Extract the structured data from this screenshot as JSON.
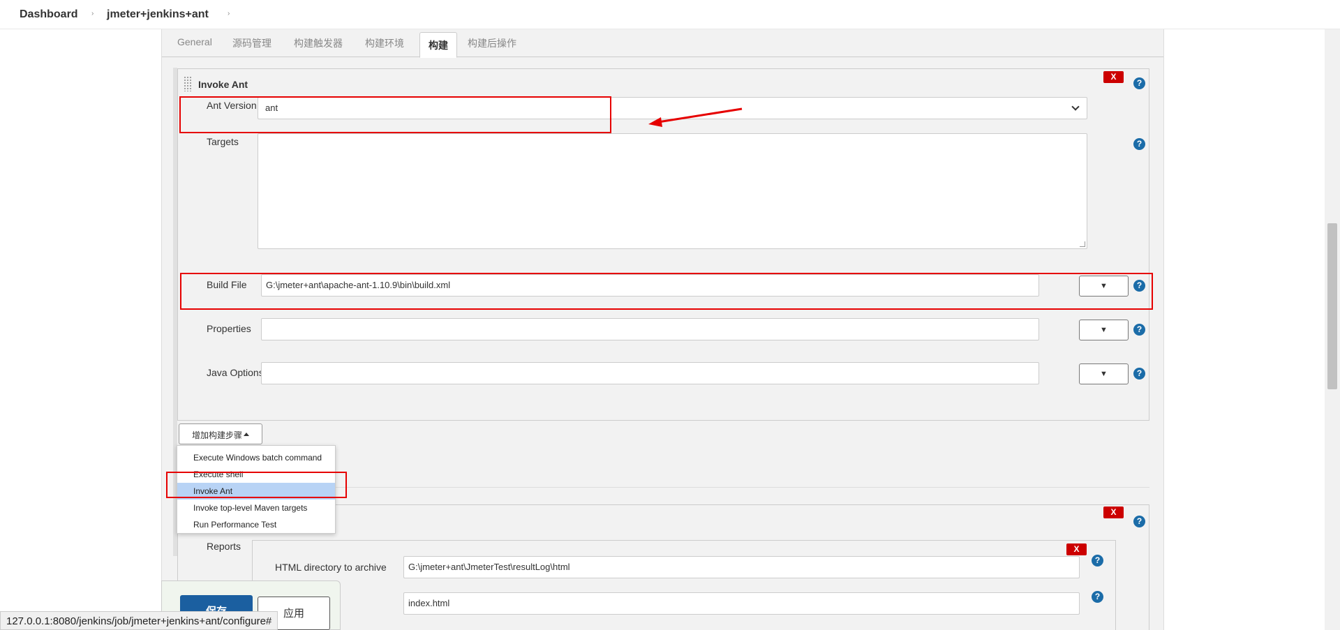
{
  "breadcrumb": {
    "items": [
      "Dashboard",
      "jmeter+jenkins+ant"
    ]
  },
  "tabs": [
    "General",
    "源码管理",
    "构建触发器",
    "构建环境",
    "构建",
    "构建后操作"
  ],
  "active_tab": "构建",
  "invoke_ant": {
    "title": "Invoke Ant",
    "delete_label": "X",
    "ant_version_label": "Ant Version",
    "ant_version_value": "ant",
    "targets_label": "Targets",
    "targets_value": "",
    "build_file_label": "Build File",
    "build_file_value": "G:\\jmeter+ant\\apache-ant-1.10.9\\bin\\build.xml",
    "properties_label": "Properties",
    "properties_value": "",
    "java_options_label": "Java Options",
    "java_options_value": "",
    "expand_glyph": "▼",
    "help_glyph": "?"
  },
  "add_step": {
    "label": "增加构建步骤",
    "menu_items": [
      "Execute Windows batch command",
      "Execute shell",
      "Invoke Ant",
      "Invoke top-level Maven targets",
      "Run Performance Test"
    ],
    "selected": "Invoke Ant"
  },
  "publish_html": {
    "delete_label": "X",
    "reports_label": "Reports",
    "html_dir_label": "HTML directory to archive",
    "html_dir_value": "G:\\jmeter+ant\\JmeterTest\\resultLog\\html",
    "index_value": "index.html"
  },
  "footer": {
    "save_label": "保存",
    "apply_label": "应用",
    "status_url": "127.0.0.1:8080/jenkins/job/jmeter+jenkins+ant/configure#"
  },
  "colors": {
    "highlight": "#e60000",
    "help": "#1b6ca8",
    "delete": "#cc0000",
    "save": "#1b5fa0",
    "menu_selected": "#b8d3f5"
  }
}
